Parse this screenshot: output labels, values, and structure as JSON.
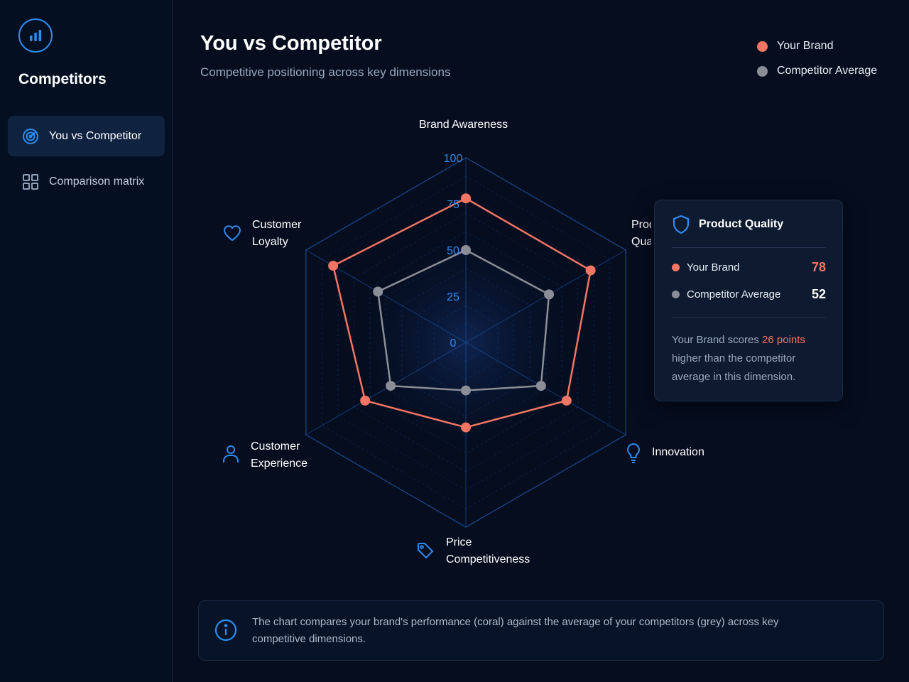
{
  "sidebar": {
    "title": "Competitors",
    "logo_icon": "bar-chart-icon",
    "items": [
      {
        "label": "You vs Competitor",
        "icon": "radar-icon",
        "active": true
      },
      {
        "label": "Comparison matrix",
        "icon": "grid-icon",
        "active": false
      }
    ]
  },
  "header": {
    "title": "You vs Competitor",
    "subtitle": "Competitive positioning across key dimensions"
  },
  "legend": [
    {
      "label": "Your Brand",
      "color": "#f47563"
    },
    {
      "label": "Competitor Average",
      "color": "#8b8e96"
    }
  ],
  "chart_data": {
    "type": "radar",
    "axes": [
      {
        "label": "Brand Awareness",
        "icon": null
      },
      {
        "label": "Product Quality",
        "icon": "shield-icon"
      },
      {
        "label": "Innovation",
        "icon": "lightbulb-icon"
      },
      {
        "label": "Price Competitiveness",
        "icon": "tag-icon"
      },
      {
        "label": "Customer Experience",
        "icon": "user-icon"
      },
      {
        "label": "Customer Loyalty",
        "icon": "heart-icon"
      }
    ],
    "ticks": [
      "0",
      "25",
      "50",
      "75",
      "100"
    ],
    "range": [
      0,
      100
    ],
    "series": [
      {
        "name": "Your Brand",
        "color": "#f47563",
        "values": [
          78,
          78,
          63,
          46,
          63,
          83
        ]
      },
      {
        "name": "Competitor Average",
        "color": "#8b8e96",
        "values": [
          50,
          52,
          47,
          26,
          47,
          55
        ]
      }
    ],
    "grid_color": "#1f5fb8"
  },
  "tooltip": {
    "title": "Product Quality",
    "icon": "shield-icon",
    "rows": [
      {
        "label": "Your Brand",
        "value": "78",
        "color": "#f47563"
      },
      {
        "label": "Competitor Average",
        "value": "52",
        "color": "#8b8e96"
      }
    ],
    "note_prefix": "Your Brand scores ",
    "note_highlight": "26 points",
    "note_suffix": " higher than the competitor average in this dimension."
  },
  "info": {
    "icon": "info-icon",
    "text": "The chart compares your brand's performance (coral) against the average of your competitors (grey) across key competitive dimensions."
  }
}
